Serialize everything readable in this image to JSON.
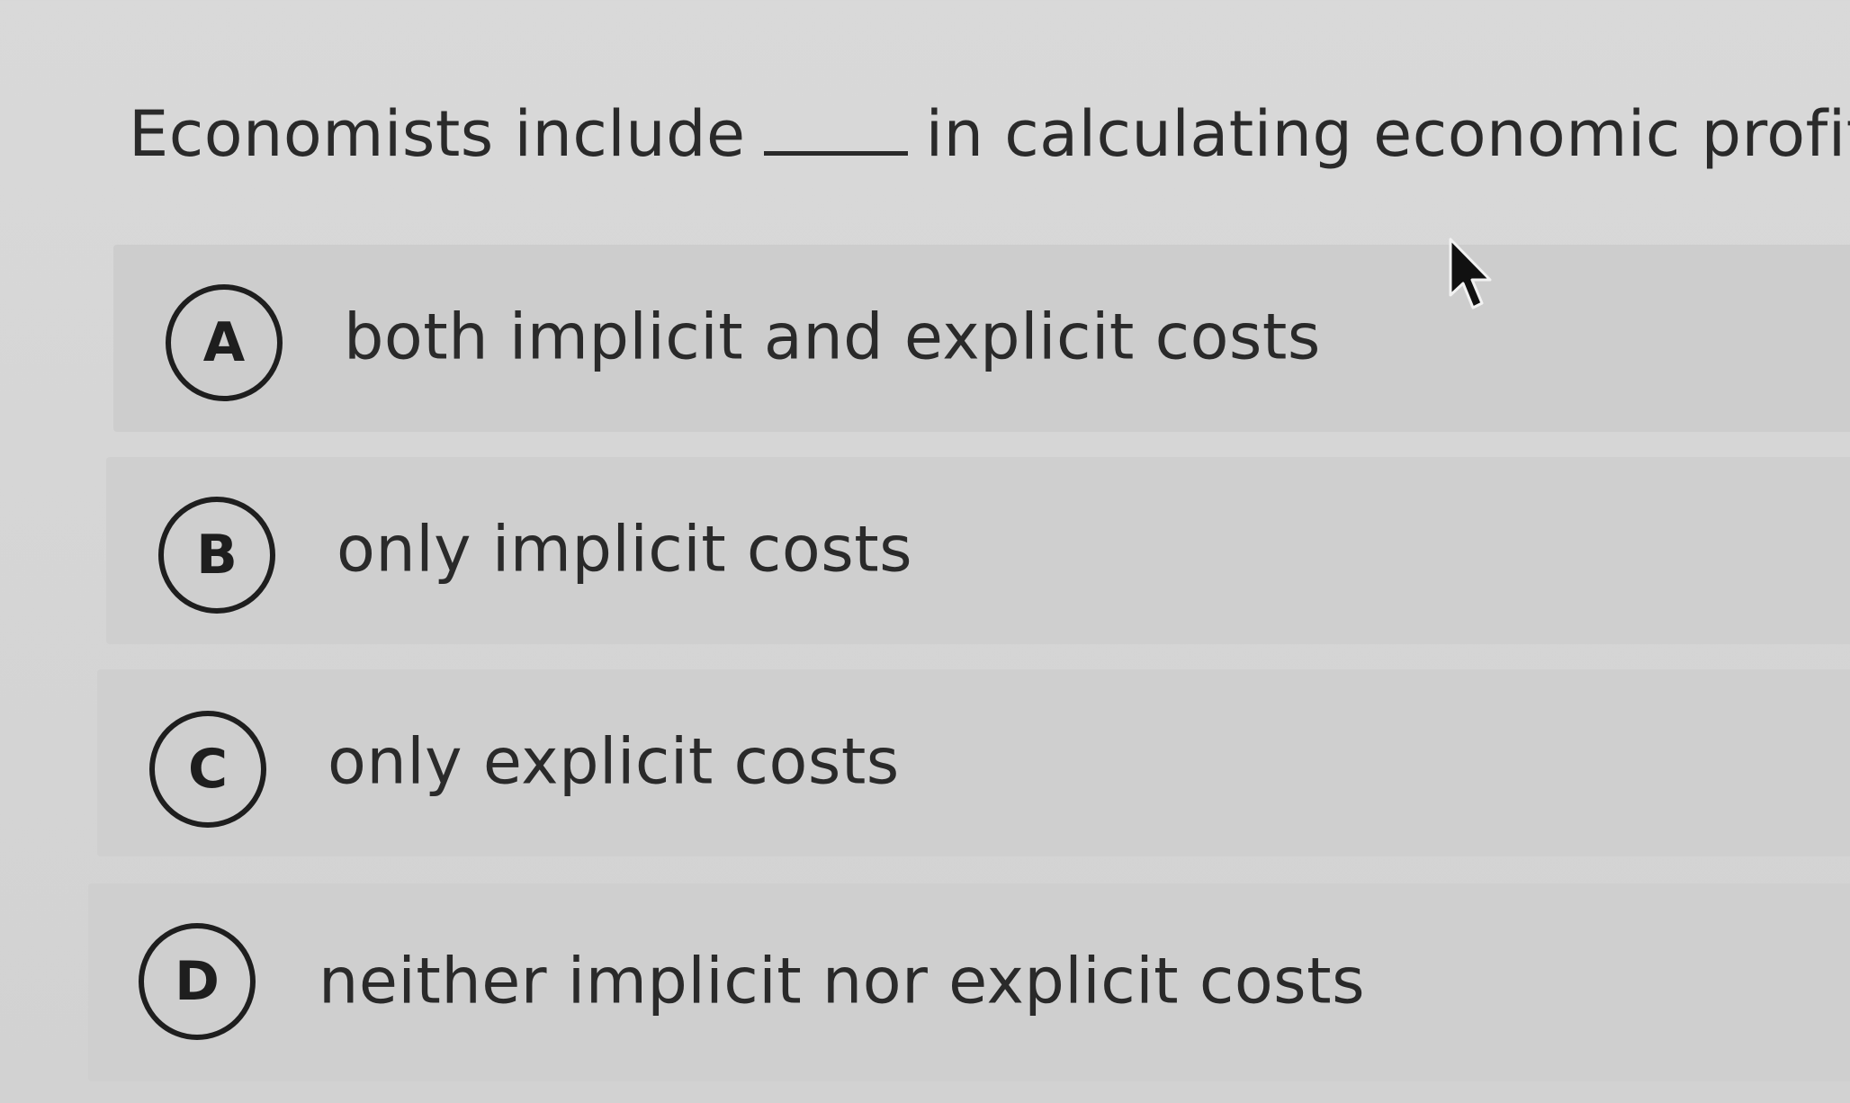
{
  "question": {
    "before_blank": "Economists include",
    "after_blank": "in calculating economic profit."
  },
  "options": [
    {
      "letter": "A",
      "text": "both implicit and explicit costs"
    },
    {
      "letter": "B",
      "text": "only implicit costs"
    },
    {
      "letter": "C",
      "text": "only explicit costs"
    },
    {
      "letter": "D",
      "text": "neither implicit nor explicit costs"
    }
  ],
  "cursor": {
    "icon": "mouse-pointer-icon"
  }
}
